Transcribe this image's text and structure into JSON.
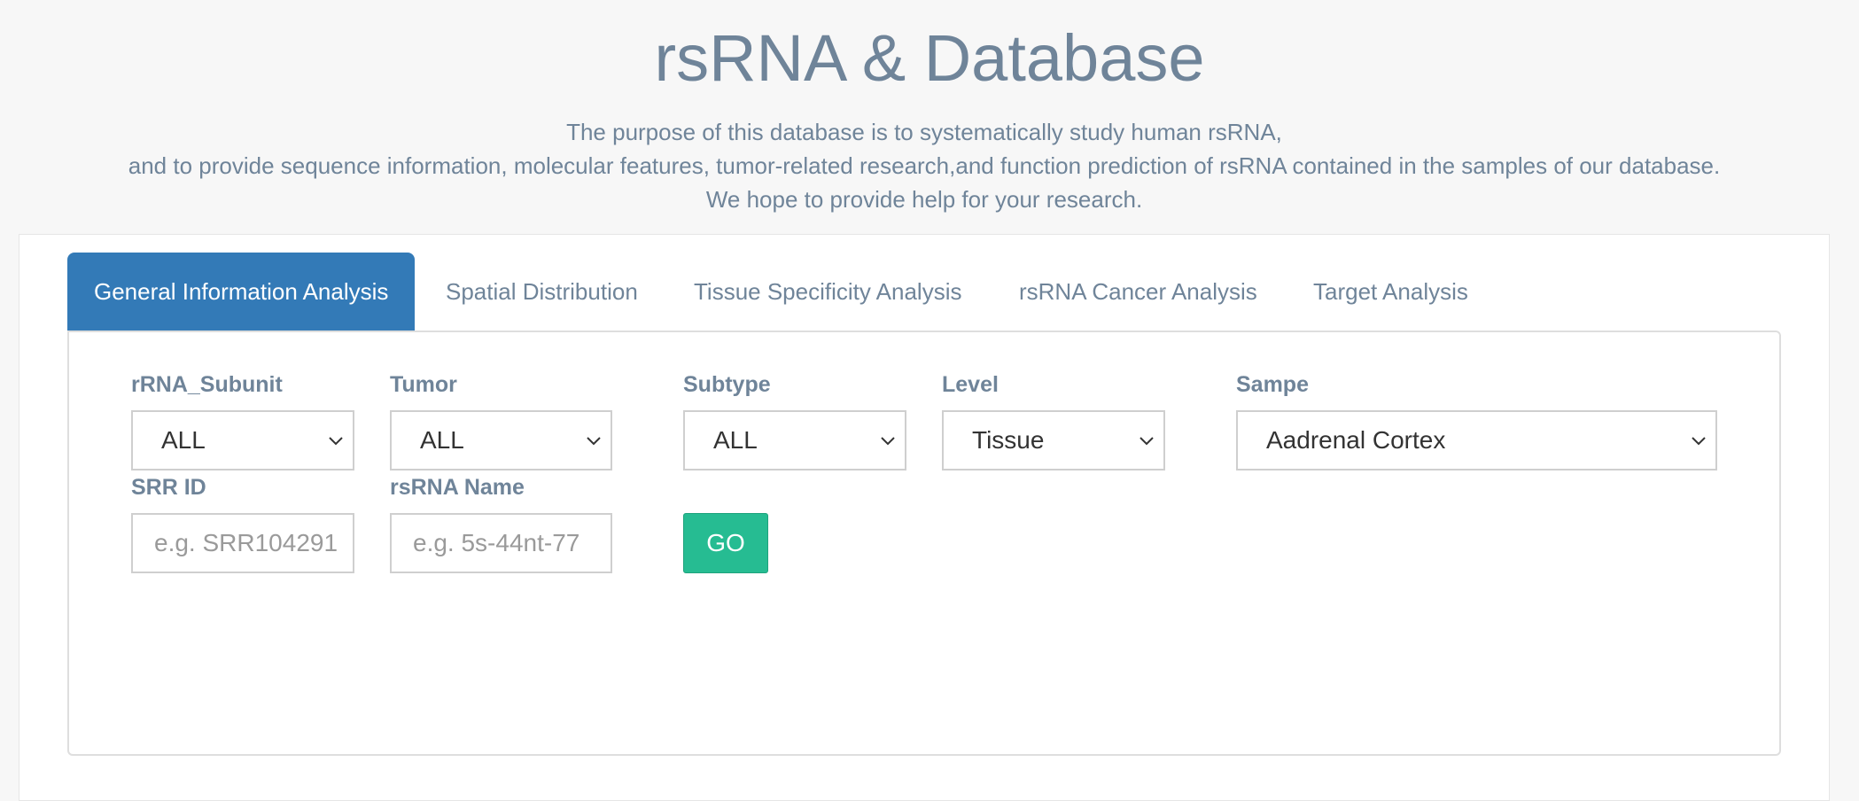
{
  "header": {
    "title": "rsRNA & Database",
    "desc_line1": "The purpose of this database is to systematically study human rsRNA,",
    "desc_line2": "and to provide sequence information, molecular features, tumor-related research,and function prediction of rsRNA contained in the samples of our database.",
    "desc_line3": "We hope to provide help for your research."
  },
  "tabs": [
    {
      "label": "General Information Analysis",
      "active": true
    },
    {
      "label": "Spatial Distribution",
      "active": false
    },
    {
      "label": "Tissue Specificity Analysis",
      "active": false
    },
    {
      "label": "rsRNA Cancer Analysis",
      "active": false
    },
    {
      "label": "Target Analysis",
      "active": false
    }
  ],
  "filters": {
    "rrna_subunit": {
      "label": "rRNA_Subunit",
      "value": "ALL"
    },
    "tumor": {
      "label": "Tumor",
      "value": "ALL"
    },
    "subtype": {
      "label": "Subtype",
      "value": "ALL"
    },
    "level": {
      "label": "Level",
      "value": "Tissue"
    },
    "sample": {
      "label": "Sampe",
      "value": "Aadrenal Cortex"
    },
    "srr_id": {
      "label": "SRR ID",
      "placeholder": "e.g. SRR104291"
    },
    "rsrna_name": {
      "label": "rsRNA Name",
      "placeholder": "e.g. 5s-44nt-77"
    }
  },
  "go_label": "GO",
  "icons": {
    "select_arrow": "chevron-down-icon"
  }
}
